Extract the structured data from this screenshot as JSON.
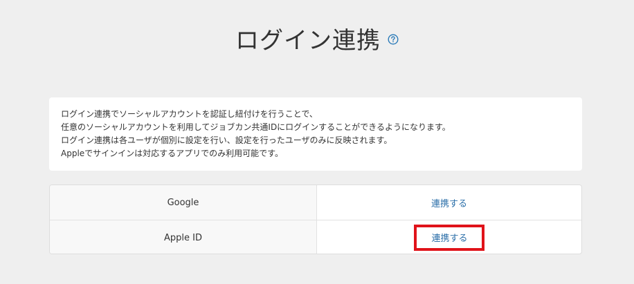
{
  "header": {
    "title": "ログイン連携",
    "help_icon": "question-circle-icon",
    "help_color": "#2a7ab8"
  },
  "description": {
    "lines": [
      "ログイン連携でソーシャルアカウントを認証し紐付けを行うことで、",
      "任意のソーシャルアカウントを利用してジョブカン共通IDにログインすることができるようになります。",
      "ログイン連携は各ユーザが個別に設定を行い、設定を行ったユーザのみに反映されます。",
      "Appleでサインインは対応するアプリでのみ利用可能です。"
    ]
  },
  "providers": [
    {
      "name": "Google",
      "action_label": "連携する"
    },
    {
      "name": "Apple ID",
      "action_label": "連携する"
    }
  ],
  "colors": {
    "link": "#2a6ea8",
    "highlight_border": "#e0131a",
    "background": "#efefef"
  }
}
